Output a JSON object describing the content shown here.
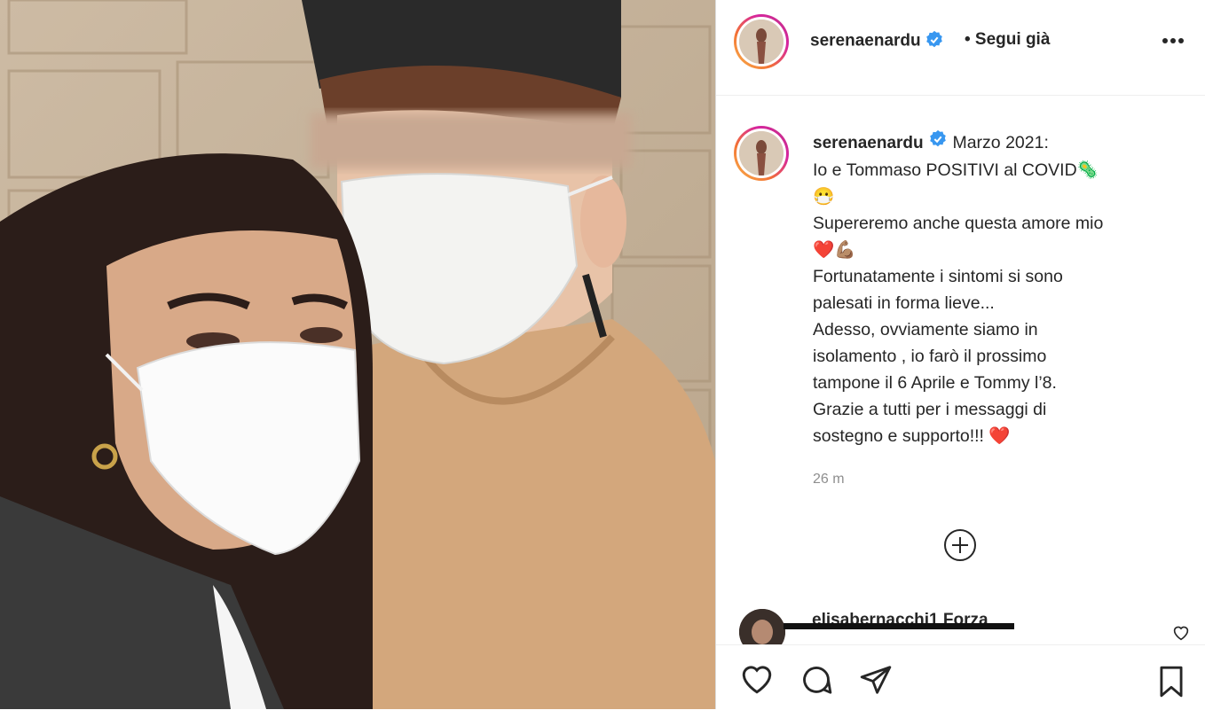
{
  "post": {
    "username": "serenaenardu",
    "follow_label": "• Segui già",
    "caption_lines": [
      "Marzo 2021:",
      "Io e Tommaso POSITIVI al COVID🦠",
      "😷",
      "Supereremo anche questa amore mio",
      "❤️💪🏽",
      "Fortunatamente i sintomi si sono",
      "palesati in forma lieve...",
      "Adesso, ovviamente siamo in",
      "isolamento , io farò il prossimo",
      "tampone il 6 Aprile e Tommy l’8.",
      "Grazie a tutti per i messaggi di",
      "sostegno e supporto!!! ❤️"
    ],
    "time": "26 m"
  },
  "comment": {
    "text": "elisabernacchi1 Forza"
  },
  "icons": {
    "more": "more-options-icon",
    "verified": "verified-badge-icon",
    "load_more": "plus-circle-icon",
    "like": "heart-icon",
    "comment": "comment-icon",
    "share": "share-icon",
    "save": "bookmark-icon"
  },
  "colors": {
    "verified": "#3897f0",
    "text": "#262626",
    "muted": "#8e8e8e"
  }
}
